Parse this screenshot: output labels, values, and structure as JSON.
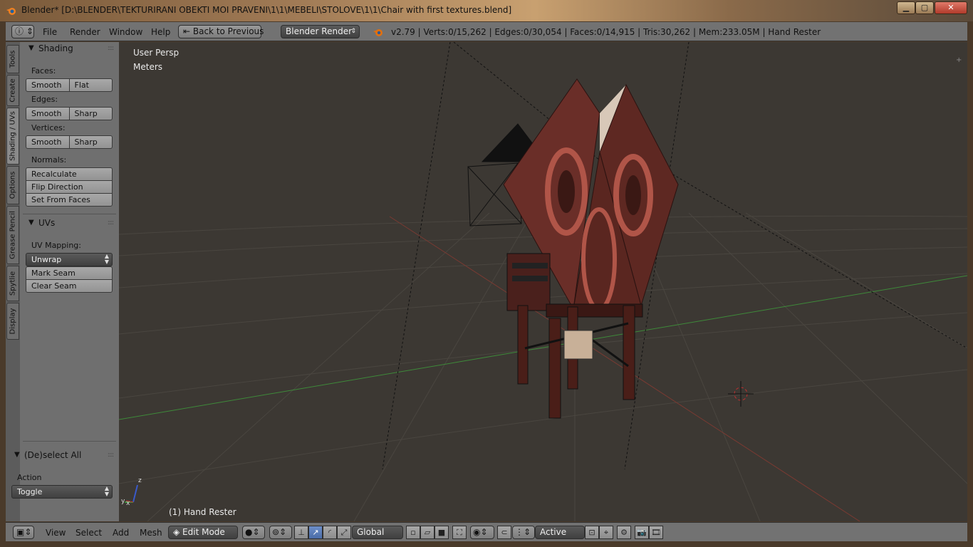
{
  "window": {
    "title": "Blender* [D:\\BLENDER\\TEKTURIRANI OBEKTI MOI PRAVENI\\1\\1\\MEBELI\\STOLOVE\\1\\1\\Chair with first textures.blend]",
    "minimize_glyph": "▁",
    "maximize_glyph": "▢",
    "close_glyph": "✕"
  },
  "info_header": {
    "editor_icon": "info-icon",
    "menus": [
      "File",
      "Render",
      "Window",
      "Help"
    ],
    "back_button": "Back to Previous",
    "render_engine": "Blender Render",
    "stats": "v2.79 | Verts:0/15,262 | Edges:0/30,054 | Faces:0/14,915 | Tris:30,262 | Mem:233.05M | Hand Rester"
  },
  "tool_tabs": [
    "Tools",
    "Create",
    "Shading / UVs",
    "Options",
    "Grease Pencil",
    "Spytlie",
    "Display"
  ],
  "shading_panel": {
    "title": "Shading",
    "faces_label": "Faces:",
    "faces_buttons": [
      "Smooth",
      "Flat"
    ],
    "edges_label": "Edges:",
    "edges_buttons": [
      "Smooth",
      "Sharp"
    ],
    "vertices_label": "Vertices:",
    "vertices_buttons": [
      "Smooth",
      "Sharp"
    ],
    "normals_label": "Normals:",
    "normals_buttons": [
      "Recalculate",
      "Flip Direction",
      "Set From Faces"
    ]
  },
  "uvs_panel": {
    "title": "UVs",
    "mapping_label": "UV Mapping:",
    "unwrap": "Unwrap",
    "buttons": [
      "Mark Seam",
      "Clear Seam"
    ]
  },
  "operator_panel": {
    "title": "(De)select All",
    "action_label": "Action",
    "action_value": "Toggle"
  },
  "viewport": {
    "view_name": "User Persp",
    "units": "Meters",
    "object_info": "(1) Hand Rester",
    "axis_z": "z",
    "axis_y": "y",
    "axis_x": "x"
  },
  "bottom_header": {
    "menus": [
      "View",
      "Select",
      "Add",
      "Mesh"
    ],
    "mode": "Edit Mode",
    "orientation": "Global",
    "pivot_label": "Active"
  },
  "colors": {
    "viewport_bg": "#3c3833",
    "grid_line": "#4a4640",
    "x_axis": "#7a3a32",
    "y_axis": "#3e8a3a",
    "wood": "#6a2e28",
    "header_bg": "#727272",
    "toolshelf_bg": "#6f6f6f"
  }
}
